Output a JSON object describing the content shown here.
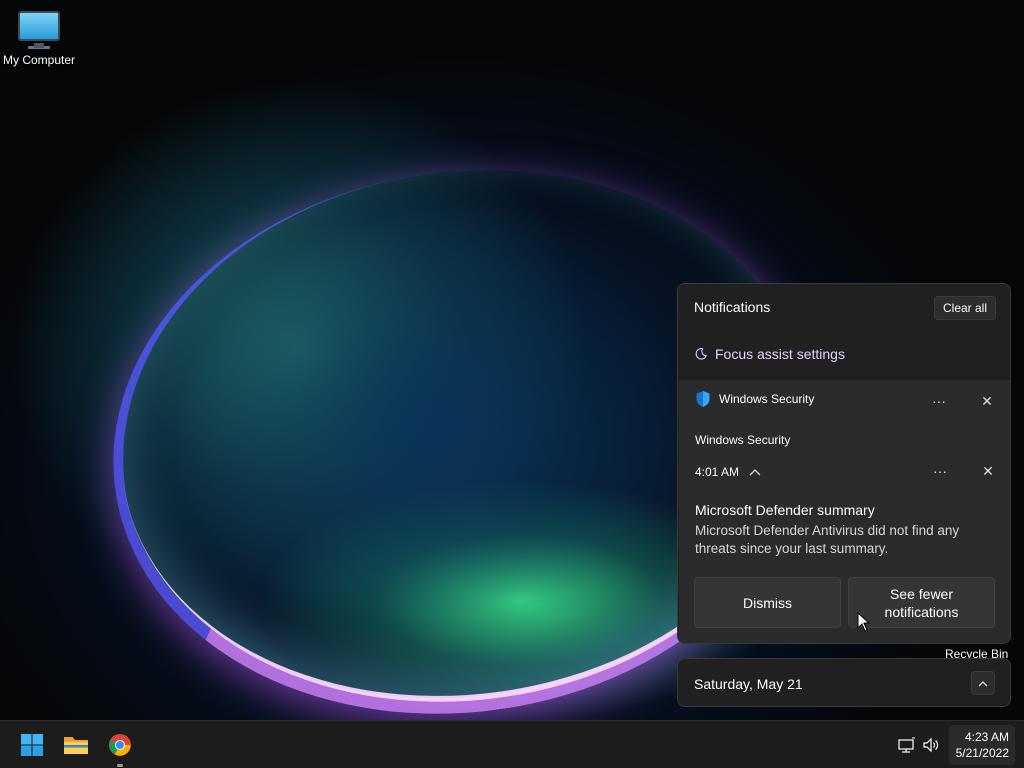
{
  "desktop": {
    "icons": [
      {
        "label": "My Computer"
      }
    ],
    "recycle_bin_label": "Recycle Bin"
  },
  "notification_center": {
    "title": "Notifications",
    "clear_all_label": "Clear all",
    "focus_assist_label": "Focus assist settings",
    "notification": {
      "app_name": "Windows Security",
      "group_name": "Windows Security",
      "time": "4:01 AM",
      "title": "Microsoft Defender summary",
      "body": "Microsoft Defender Antivirus did not find any threats since your last summary.",
      "more_glyph": "···",
      "close_glyph": "✕",
      "actions": [
        {
          "label": "Dismiss"
        },
        {
          "label": "See fewer notifications"
        }
      ]
    }
  },
  "calendar_bar": {
    "date": "Saturday, May 21"
  },
  "taskbar": {
    "pinned": [
      "windows-start-icon",
      "file-explorer-icon",
      "chrome-icon"
    ],
    "tray": [
      "network-icon",
      "volume-icon"
    ],
    "clock": {
      "time": "4:23 AM",
      "date": "5/21/2022"
    }
  },
  "colors": {
    "accent": "#0078d4",
    "focus_text": "#e4d3ff",
    "panel_bg": "#202020",
    "card_bg": "#2b2b2b"
  }
}
